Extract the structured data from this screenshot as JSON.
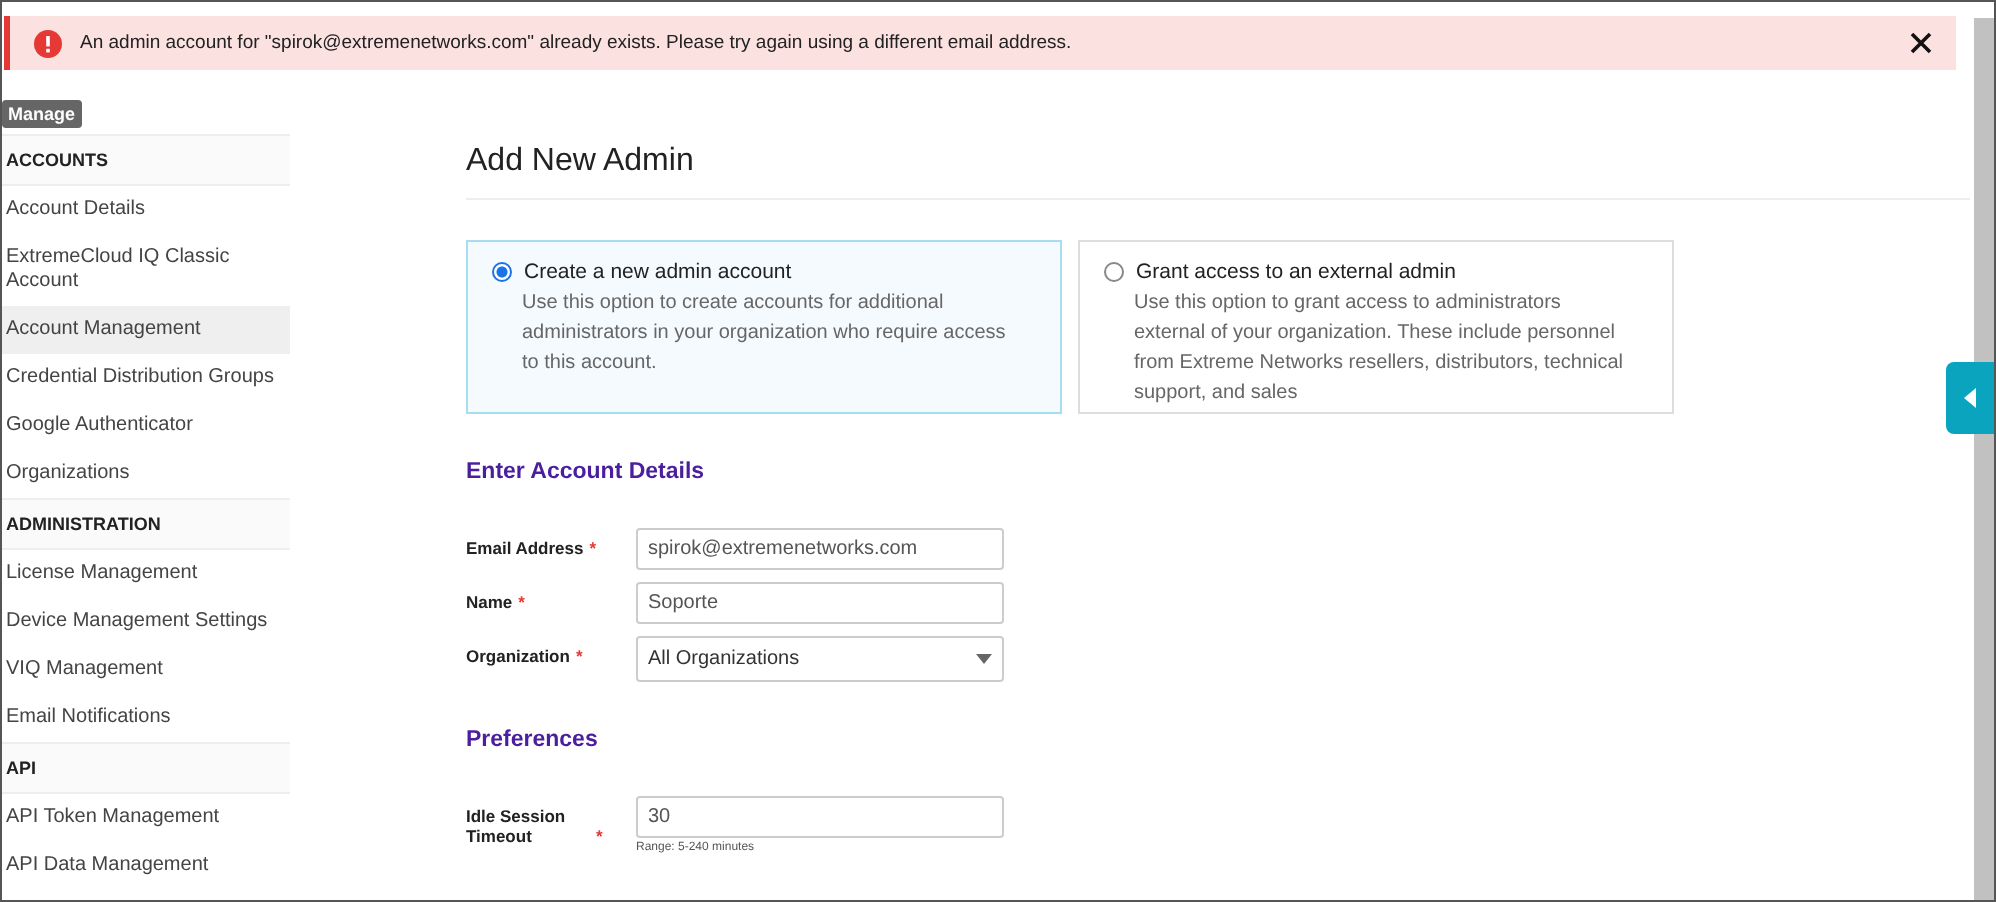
{
  "alert": {
    "message": "An admin account for \"spirok@extremenetworks.com\" already exists. Please try again using a different email address."
  },
  "tooltip": "Manage",
  "sidebar": {
    "sections": [
      {
        "title": "ACCOUNTS",
        "items": [
          {
            "label": "Account Details",
            "selected": false
          },
          {
            "label": "ExtremeCloud IQ Classic Account",
            "selected": false
          },
          {
            "label": "Account Management",
            "selected": true
          },
          {
            "label": "Credential Distribution Groups",
            "selected": false
          },
          {
            "label": "Google Authenticator",
            "selected": false
          },
          {
            "label": "Organizations",
            "selected": false
          }
        ]
      },
      {
        "title": "ADMINISTRATION",
        "items": [
          {
            "label": "License Management",
            "selected": false
          },
          {
            "label": "Device Management Settings",
            "selected": false
          },
          {
            "label": "VIQ Management",
            "selected": false
          },
          {
            "label": "Email Notifications",
            "selected": false
          }
        ]
      },
      {
        "title": "API",
        "items": [
          {
            "label": "API Token Management",
            "selected": false
          },
          {
            "label": "API Data Management",
            "selected": false
          }
        ]
      }
    ]
  },
  "page_title": "Add New Admin",
  "options": [
    {
      "title": "Create a new admin account",
      "description": "Use this option to create accounts for additional administrators in your organization who require access to this account.",
      "selected": true
    },
    {
      "title": "Grant access to an external admin",
      "description": "Use this option to grant access to administrators external of your organization. These include personnel from Extreme Networks resellers, distributors, technical support, and sales",
      "selected": false
    }
  ],
  "sections": [
    {
      "title": "Enter Account Details",
      "fields": [
        {
          "label": "Email Address",
          "required_mark": "*",
          "kind": "text",
          "value": "spirok@extremenetworks.com"
        },
        {
          "label": "Name",
          "required_mark": "*",
          "kind": "text",
          "value": "Soporte"
        },
        {
          "label": "Organization",
          "required_mark": "*",
          "kind": "select",
          "value": "All Organizations"
        }
      ]
    },
    {
      "title": "Preferences",
      "fields": [
        {
          "label": "Idle Session Timeout",
          "required_mark": "*",
          "kind": "text",
          "value": "30",
          "hint": "Range: 5-240 minutes"
        }
      ]
    }
  ]
}
